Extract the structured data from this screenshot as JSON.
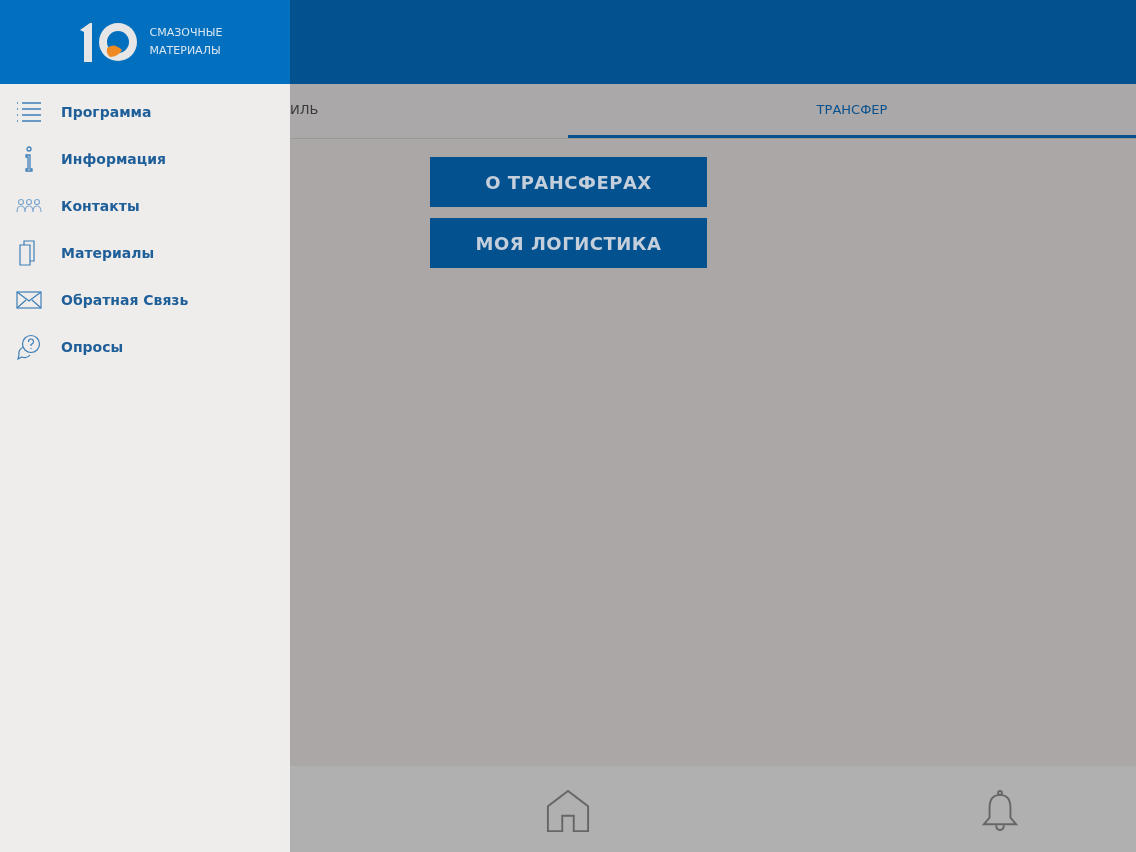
{
  "drawer": {
    "logo_lines": [
      "СМАЗОЧНЫЕ",
      "МАТЕРИАЛЫ"
    ],
    "menu": [
      {
        "label": "Программа"
      },
      {
        "label": "Информация"
      },
      {
        "label": "Контакты"
      },
      {
        "label": "Материалы"
      },
      {
        "label": "Обратная Связь"
      },
      {
        "label": "Опросы"
      }
    ]
  },
  "tabs": [
    {
      "label": "ИЛЬ",
      "selected": false
    },
    {
      "label": "ТРАНСФЕР",
      "selected": true
    }
  ],
  "buttons": [
    "О ТРАНСФЕРАХ",
    "МОЯ ЛОГИСТИКА"
  ]
}
